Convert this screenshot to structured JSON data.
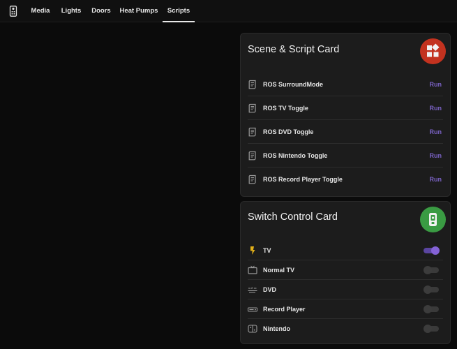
{
  "tabs": [
    {
      "label": "Media",
      "active": false
    },
    {
      "label": "Lights",
      "active": false
    },
    {
      "label": "Doors",
      "active": false
    },
    {
      "label": "Heat Pumps",
      "active": false
    },
    {
      "label": "Scripts",
      "active": true
    }
  ],
  "home_icon": "remote-control-icon",
  "scene_card": {
    "title": "Scene & Script Card",
    "badge_icon": "shapes-icon",
    "badge_color": "#c3321f",
    "action_label": "Run",
    "items": [
      {
        "label": "ROS SurroundMode",
        "icon": "script-text-icon"
      },
      {
        "label": "ROS TV Toggle",
        "icon": "script-text-icon"
      },
      {
        "label": "ROS DVD Toggle",
        "icon": "script-text-icon"
      },
      {
        "label": "ROS Nintendo Toggle",
        "icon": "script-text-icon"
      },
      {
        "label": "ROS Record Player Toggle",
        "icon": "script-text-icon"
      }
    ]
  },
  "switch_card": {
    "title": "Switch Control Card",
    "badge_icon": "remote-icon",
    "badge_color": "#3a9b43",
    "accent_color": "#8462d6",
    "items": [
      {
        "label": "TV",
        "icon": "flash-icon",
        "on": true
      },
      {
        "label": "Normal TV",
        "icon": "television-icon",
        "on": false
      },
      {
        "label": "DVD",
        "icon": "disc-player-icon",
        "on": false
      },
      {
        "label": "Record Player",
        "icon": "audio-receiver-icon",
        "on": false
      },
      {
        "label": "Nintendo",
        "icon": "nintendo-switch-icon",
        "on": false
      }
    ]
  }
}
